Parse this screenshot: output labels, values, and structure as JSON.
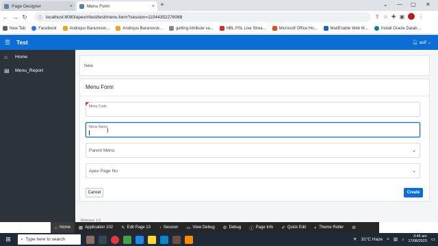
{
  "browser": {
    "tabs": [
      {
        "label": "Page Designer",
        "close": "×"
      },
      {
        "label": "Menu Form",
        "close": "×"
      }
    ],
    "new_tab": "+",
    "url": "localhost:8080/apex/r/test/test/menu-form?session=11044352276088",
    "bookmarks": [
      {
        "label": "New Tab",
        "color": "#5f6368"
      },
      {
        "label": "Facebook",
        "color": "#1877f2"
      },
      {
        "label": "Andrejus Baranovsk...",
        "color": "#f4a21a"
      },
      {
        "label": "Andrejus Baranovsk...",
        "color": "#f4a21a"
      },
      {
        "label": "getting Attribute va...",
        "color": "#888888"
      },
      {
        "label": "HBL PSL Live Strea...",
        "color": "#d32f2f"
      },
      {
        "label": "Microsoft Office Ho...",
        "color": "#e64a19"
      },
      {
        "label": "MailEnable Web M...",
        "color": "#1565c0"
      },
      {
        "label": "Install Oracle Datab...",
        "color": "#00897b"
      }
    ]
  },
  "app": {
    "title": "Test",
    "user": "asif",
    "accent": "#0c6ed4",
    "sidebar_bg": "#2d333b"
  },
  "sidebar": {
    "items": [
      {
        "label": "Home",
        "icon": "home-icon"
      },
      {
        "label": "Menu_Report",
        "icon": "report-icon"
      }
    ]
  },
  "breadcrumb": {
    "label": "New"
  },
  "form": {
    "title": "Menu Form",
    "fields": {
      "menu_code": {
        "label": "Menu Code",
        "value": ""
      },
      "menu_name": {
        "label": "Menu Name",
        "value": ""
      },
      "parent_menu": {
        "placeholder": "Parent Menu"
      },
      "apex_page_no": {
        "placeholder": "Apex Page No"
      }
    },
    "cancel_label": "Cancel",
    "create_label": "Create"
  },
  "footer": {
    "release": "Release 1.0"
  },
  "devbar": {
    "items": [
      {
        "label": "Home",
        "icon": "home-icon"
      },
      {
        "label": "Application 102",
        "icon": "app-icon"
      },
      {
        "label": "Edit Page 13",
        "icon": "edit-icon"
      },
      {
        "label": "Session",
        "icon": "session-icon"
      },
      {
        "label": "View Debug",
        "icon": "debug-view-icon"
      },
      {
        "label": "Debug",
        "icon": "debug-icon"
      },
      {
        "label": "Page Info",
        "icon": "info-icon"
      },
      {
        "label": "Quick Edit",
        "icon": "quick-edit-icon"
      },
      {
        "label": "Theme Roller",
        "icon": "theme-icon"
      }
    ]
  },
  "taskbar": {
    "search_placeholder": "Type here to search",
    "weather": "31°C  Haze",
    "time": "3:46 am",
    "date": "17/08/2023"
  }
}
